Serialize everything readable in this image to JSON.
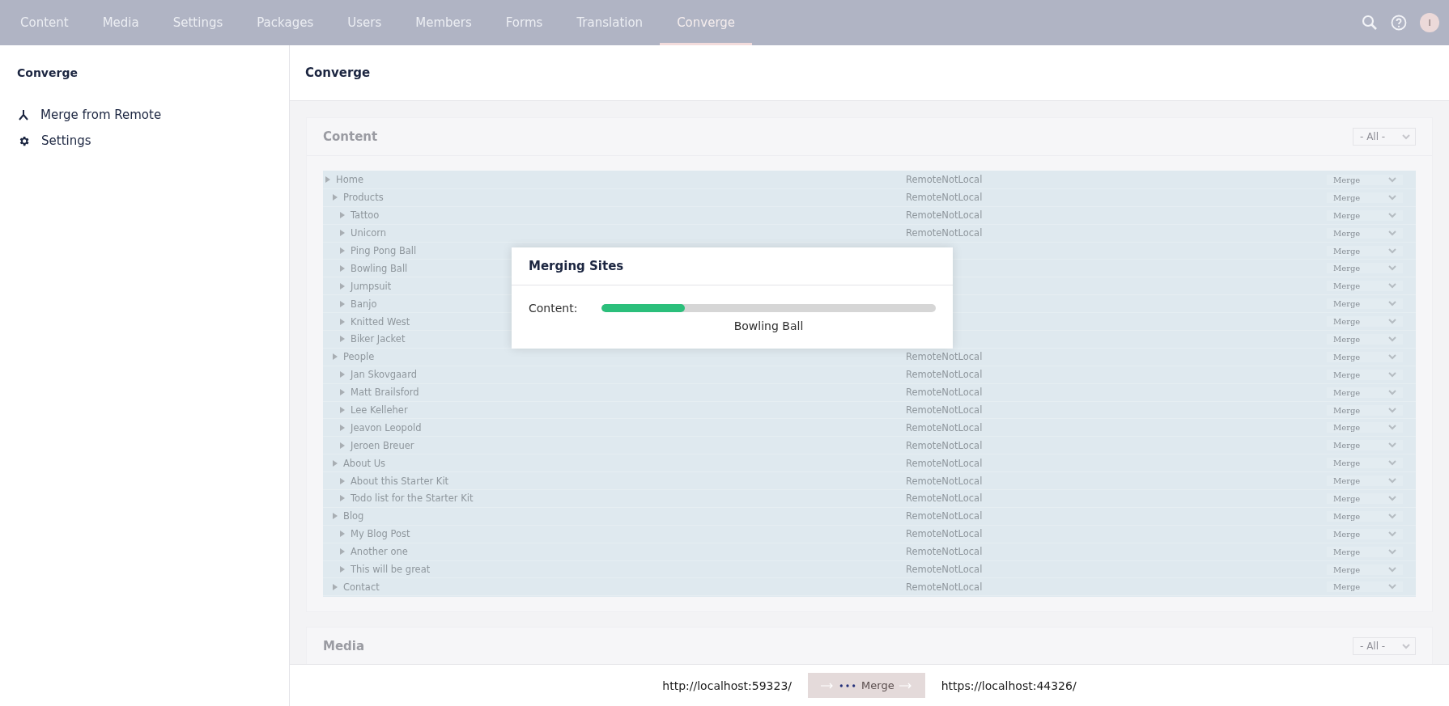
{
  "top_nav": {
    "tabs": [
      {
        "label": "Content",
        "selected": false
      },
      {
        "label": "Media",
        "selected": false
      },
      {
        "label": "Settings",
        "selected": false
      },
      {
        "label": "Packages",
        "selected": false
      },
      {
        "label": "Users",
        "selected": false
      },
      {
        "label": "Members",
        "selected": false
      },
      {
        "label": "Forms",
        "selected": false
      },
      {
        "label": "Translation",
        "selected": false
      },
      {
        "label": "Converge",
        "selected": true
      }
    ],
    "avatar": "I"
  },
  "sidebar": {
    "title": "Converge",
    "items": [
      {
        "kind": "merge",
        "label": "Merge from Remote"
      },
      {
        "kind": "settings",
        "label": "Settings"
      }
    ]
  },
  "page_title": "Converge",
  "sections": [
    {
      "title": "Content",
      "filter": "- All -",
      "tree": [
        {
          "name": "Home",
          "status": "RemoteNotLocal",
          "action": "Merge",
          "children": [
            {
              "name": "Products",
              "status": "RemoteNotLocal",
              "action": "Merge",
              "children": [
                {
                  "name": "Tattoo",
                  "status": "RemoteNotLocal",
                  "action": "Merge"
                },
                {
                  "name": "Unicorn",
                  "status": "RemoteNotLocal",
                  "action": "Merge"
                },
                {
                  "name": "Ping Pong Ball",
                  "action": "Merge"
                },
                {
                  "name": "Bowling Ball",
                  "action": "Merge"
                },
                {
                  "name": "Jumpsuit",
                  "action": "Merge"
                },
                {
                  "name": "Banjo",
                  "action": "Merge"
                },
                {
                  "name": "Knitted West",
                  "action": "Merge"
                },
                {
                  "name": "Biker Jacket",
                  "action": "Merge"
                }
              ]
            },
            {
              "name": "People",
              "status": "RemoteNotLocal",
              "action": "Merge",
              "children": [
                {
                  "name": "Jan Skovgaard",
                  "status": "RemoteNotLocal",
                  "action": "Merge"
                },
                {
                  "name": "Matt Brailsford",
                  "status": "RemoteNotLocal",
                  "action": "Merge"
                },
                {
                  "name": "Lee Kelleher",
                  "status": "RemoteNotLocal",
                  "action": "Merge"
                },
                {
                  "name": "Jeavon Leopold",
                  "status": "RemoteNotLocal",
                  "action": "Merge"
                },
                {
                  "name": "Jeroen Breuer",
                  "status": "RemoteNotLocal",
                  "action": "Merge"
                }
              ]
            },
            {
              "name": "About Us",
              "status": "RemoteNotLocal",
              "action": "Merge",
              "children": [
                {
                  "name": "About this Starter Kit",
                  "status": "RemoteNotLocal",
                  "action": "Merge"
                },
                {
                  "name": "Todo list for the Starter Kit",
                  "status": "RemoteNotLocal",
                  "action": "Merge"
                }
              ]
            },
            {
              "name": "Blog",
              "status": "RemoteNotLocal",
              "action": "Merge",
              "children": [
                {
                  "name": "My Blog Post",
                  "status": "RemoteNotLocal",
                  "action": "Merge"
                },
                {
                  "name": "Another one",
                  "status": "RemoteNotLocal",
                  "action": "Merge"
                },
                {
                  "name": "This will be great",
                  "status": "RemoteNotLocal",
                  "action": "Merge"
                }
              ]
            },
            {
              "name": "Contact",
              "status": "RemoteNotLocal",
              "action": "Merge"
            }
          ]
        }
      ]
    },
    {
      "title": "Media",
      "filter": "- All -"
    }
  ],
  "modal": {
    "title": "Merging Sites",
    "label": "Content:",
    "level": 0.25,
    "current": "Bowling Ball"
  },
  "footer": {
    "source": "http://localhost:59323/",
    "button": "Merge",
    "target": "https://localhost:44326/"
  }
}
